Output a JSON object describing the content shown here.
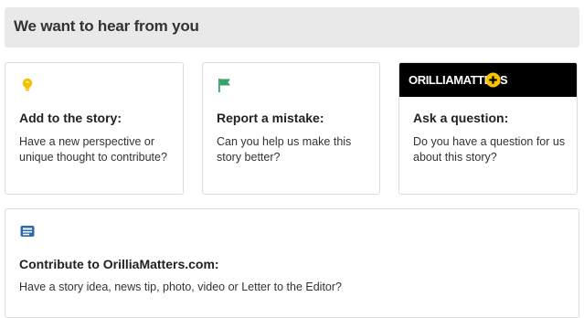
{
  "header": {
    "title": "We want to hear from you"
  },
  "cards": [
    {
      "icon": "lightbulb-icon",
      "title": "Add to the story:",
      "description": "Have a new perspective or unique thought to contribute?"
    },
    {
      "icon": "flag-icon",
      "title": "Report a mistake:",
      "description": "Can you help us make this story better?"
    },
    {
      "icon": "brand-logo",
      "brand_text": "ORILLIAMATTERS",
      "title": "Ask a question:",
      "description": "Do you have a question for us about this story?"
    }
  ],
  "contribute": {
    "icon": "news-icon",
    "title": "Contribute to OrilliaMatters.com:",
    "description": "Have a story idea, news tip, photo, video or Letter to the Editor?"
  },
  "colors": {
    "lightbulb": "#f2c200",
    "flag": "#3aa36a",
    "brand_plus": "#f7c400",
    "news_icon": "#2b6cb0"
  }
}
